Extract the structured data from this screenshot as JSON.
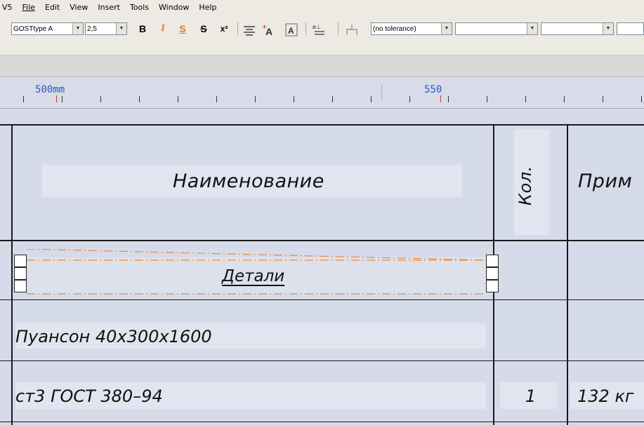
{
  "menu": {
    "items": [
      "V5",
      "File",
      "Edit",
      "View",
      "Insert",
      "Tools",
      "Window",
      "Help"
    ]
  },
  "toolbar": {
    "font_name": "GOSTtype A",
    "font_size": "2,5",
    "bold_label": "B",
    "italic_label": "I",
    "underline_label": "S",
    "strike_label": "S",
    "superscript_label": "x²",
    "tolerance": "(no tolerance)"
  },
  "ruler": {
    "label_1": "500mm",
    "label_2": "550"
  },
  "table": {
    "header_name": "Наименование",
    "header_qty": "Кол.",
    "header_note": "Прим",
    "section_title": "Детали",
    "rows": [
      {
        "name": "Пуансон 40х300х1600",
        "qty": "",
        "note": ""
      },
      {
        "name": "ст3 ГОСТ 380–94",
        "qty": "1",
        "note": "132 кг"
      }
    ]
  },
  "colors": {
    "ruler_text": "#2b57c8",
    "ruler_marker": "#e03030",
    "dash_line": "#f0883a"
  }
}
